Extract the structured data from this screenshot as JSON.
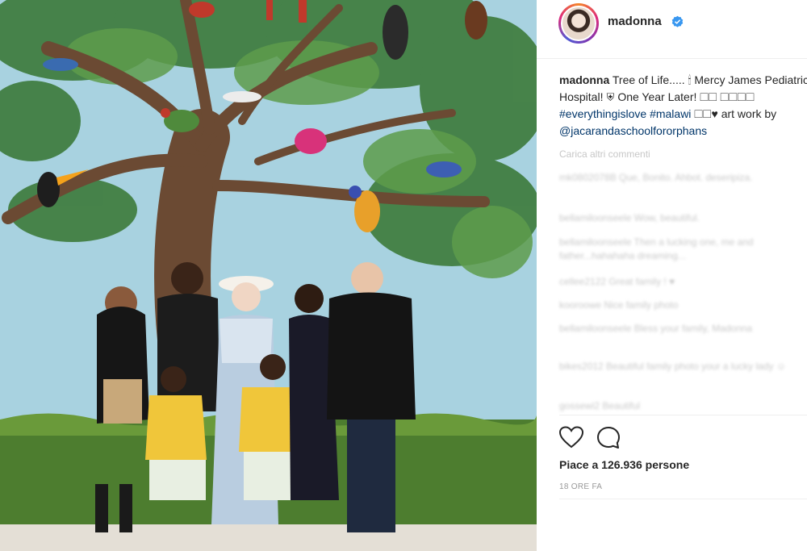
{
  "post": {
    "image_alt": "Family photo in front of a Tree of Life mural"
  },
  "header": {
    "username": "madonna",
    "verified_icon": "verified-badge-icon",
    "accent": "#3897f0"
  },
  "caption": {
    "username": "madonna",
    "text_1": "Tree of Life..... 🕯 Mercy James Pediatric Hospital! ⛨ One Year Later! ☐☐ ☐☐☐☐ ",
    "tag_1": "#everythingislove",
    "tag_2": "#malawi",
    "text_2": " ☐☐♥ art work by ",
    "mention": "@jacarandaschoolfororphans"
  },
  "comments": {
    "load_more": "Carica altri commenti",
    "items": [
      {
        "text": "mk0802078B Que, Bonito. Ahbot. deseripiza."
      },
      {
        "text": "bellamiloonseele Wow, beautiful."
      },
      {
        "text": "bellamiloonseele Then a lucking one, me and father...hahahaha dreaming..."
      },
      {
        "text": "cellee2122 Great family ! ♥"
      },
      {
        "text": "kooroowe Nice family photo"
      },
      {
        "text": "bellamiloonseele Bless your family, Madonna"
      },
      {
        "text": "bikes2012 Beautiful family photo your a lucky lady ☺"
      },
      {
        "text": "gossewi2 Beautiful"
      }
    ]
  },
  "actions": {
    "like_icon": "heart-icon",
    "comment_icon": "comment-icon"
  },
  "likes": {
    "label": "Piace a 126.936 persone"
  },
  "timestamp": "18 ORE FA"
}
